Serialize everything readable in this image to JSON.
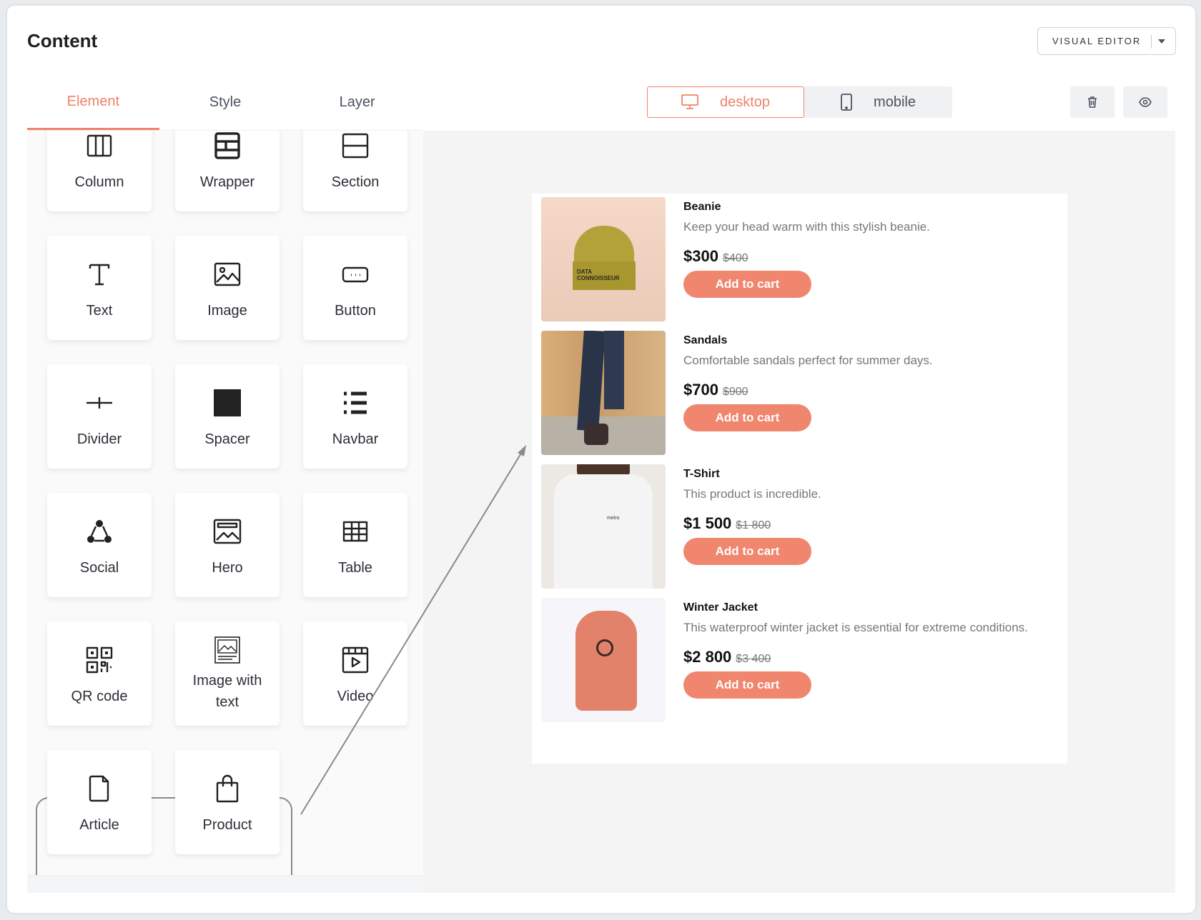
{
  "header": {
    "title": "Content",
    "mode_button": "VISUAL EDITOR"
  },
  "tabs": [
    {
      "label": "Element",
      "active": true
    },
    {
      "label": "Style"
    },
    {
      "label": "Layer"
    }
  ],
  "elements": [
    {
      "label": "Column",
      "icon": "columns-icon"
    },
    {
      "label": "Wrapper",
      "icon": "wrapper-icon"
    },
    {
      "label": "Section",
      "icon": "section-icon"
    },
    {
      "label": "Text",
      "icon": "text-icon"
    },
    {
      "label": "Image",
      "icon": "image-icon"
    },
    {
      "label": "Button",
      "icon": "button-icon"
    },
    {
      "label": "Divider",
      "icon": "divider-icon"
    },
    {
      "label": "Spacer",
      "icon": "spacer-icon"
    },
    {
      "label": "Navbar",
      "icon": "navbar-icon"
    },
    {
      "label": "Social",
      "icon": "social-icon"
    },
    {
      "label": "Hero",
      "icon": "hero-icon"
    },
    {
      "label": "Table",
      "icon": "table-icon"
    },
    {
      "label": "QR code",
      "icon": "qr-code-icon"
    },
    {
      "label": "Image with text",
      "icon": "image-with-text-icon"
    },
    {
      "label": "Video",
      "icon": "video-icon"
    },
    {
      "label": "Article",
      "icon": "article-icon"
    },
    {
      "label": "Product",
      "icon": "shopping-bag-icon"
    }
  ],
  "device": {
    "desktop": "desktop",
    "mobile": "mobile",
    "active": "desktop"
  },
  "accent": "#f0826a",
  "products": [
    {
      "name": "Beanie",
      "description": "Keep your head warm with this stylish beanie.",
      "price": "$300",
      "old_price": "$400",
      "button": "Add to cart",
      "image_text": "DATA CONNOISSEUR"
    },
    {
      "name": "Sandals",
      "description": "Comfortable sandals perfect for summer days.",
      "price": "$700",
      "old_price": "$900",
      "button": "Add to cart"
    },
    {
      "name": "T-Shirt",
      "description": "This product is incredible.",
      "price": "$1 500",
      "old_price": "$1 800",
      "button": "Add to cart",
      "image_text": "meiro"
    },
    {
      "name": "Winter Jacket",
      "description": "This waterproof winter jacket is essential for extreme conditions.",
      "price": "$2 800",
      "old_price": "$3 400",
      "button": "Add to cart"
    }
  ]
}
